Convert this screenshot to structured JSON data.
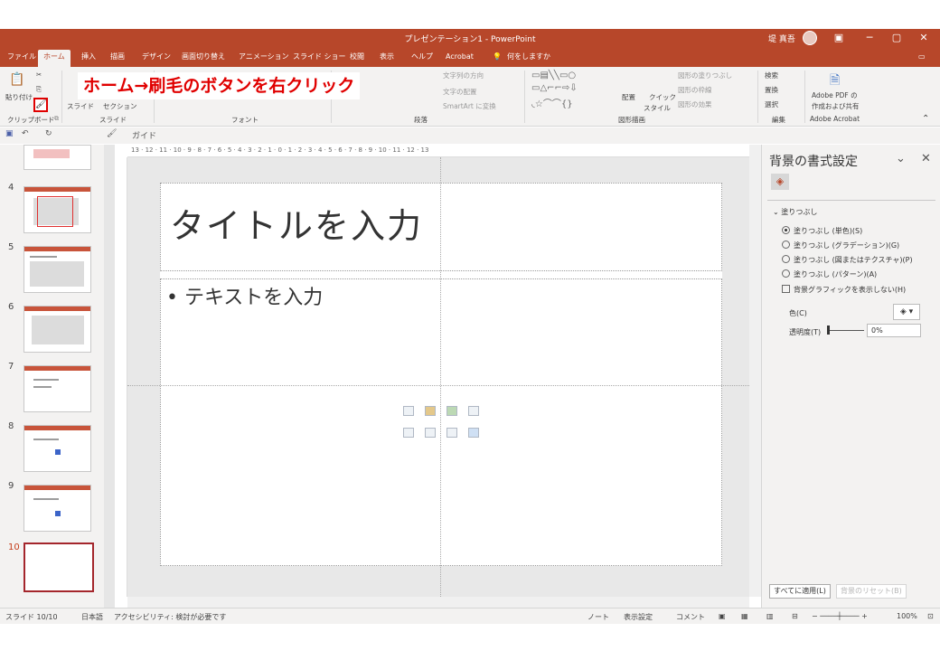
{
  "window": {
    "title": "プレゼンテーション1 - PowerPoint",
    "user": "堤 真吾"
  },
  "tabs": [
    "ファイル",
    "ホーム",
    "挿入",
    "描画",
    "デザイン",
    "画面切り替え",
    "アニメーション",
    "スライド ショー",
    "校閲",
    "表示",
    "ヘルプ",
    "Acrobat"
  ],
  "tell_me": "何をしますか",
  "ribbon": {
    "paste": "貼り付け",
    "new_slide": "スライド",
    "section": "セクション",
    "group_clipboard": "クリップボード",
    "group_slide": "スライド",
    "group_font": "フォント",
    "group_paragraph": "段落",
    "group_drawing": "図形描画",
    "group_edit": "編集",
    "group_acrobat": "Adobe Acrobat",
    "text_direction": "文字列の方向",
    "text_align": "文字の配置",
    "smartart": "SmartArt に変換",
    "arrange": "配置",
    "quick_style": "クイック",
    "quick_style2": "スタイル",
    "shape_fill": "図形の塗りつぶし",
    "shape_outline": "図形の枠線",
    "shape_effect": "図形の効果",
    "find": "検索",
    "replace": "置換",
    "select": "選択",
    "adobe_pdf1": "Adobe PDF の",
    "adobe_pdf2": "作成および共有"
  },
  "annotation": "ホーム→刷毛のボタンを右クリック",
  "qat": {
    "guide": "ガイド"
  },
  "thumbnails": [
    {
      "num": "4"
    },
    {
      "num": "5"
    },
    {
      "num": "6"
    },
    {
      "num": "7"
    },
    {
      "num": "8"
    },
    {
      "num": "9"
    },
    {
      "num": "10"
    }
  ],
  "ruler_h": "13 · 12 · 11 · 10 · 9 · 8 · 7 · 6 · 5 · 4 · 3 · 2 · 1 · 0 · 1 · 2 · 3 · 4 · 5 · 6 · 7 · 8 · 9 · 10 · 11 · 12 · 13",
  "slide": {
    "title_placeholder": "タイトルを入力",
    "body_placeholder": "• テキストを入力"
  },
  "pane": {
    "title": "背景の書式設定",
    "section": "塗りつぶし",
    "options": [
      "塗りつぶし (単色)(S)",
      "塗りつぶし (グラデーション)(G)",
      "塗りつぶし (図またはテクスチャ)(P)",
      "塗りつぶし (パターン)(A)"
    ],
    "hide_graphics": "背景グラフィックを表示しない(H)",
    "color_label": "色(C)",
    "transparency_label": "透明度(T)",
    "transparency_value": "0%",
    "transparency_level": 0,
    "apply_all": "すべてに適用(L)",
    "reset": "背景のリセット(B)"
  },
  "status": {
    "slide_info": "スライド 10/10",
    "language": "日本語",
    "accessibility": "アクセシビリティ: 検討が必要です",
    "notes": "ノート",
    "display": "表示設定",
    "comments": "コメント",
    "zoom": "100%"
  },
  "colors": {
    "accent": "#b7472a",
    "annotation": "#e00000"
  }
}
